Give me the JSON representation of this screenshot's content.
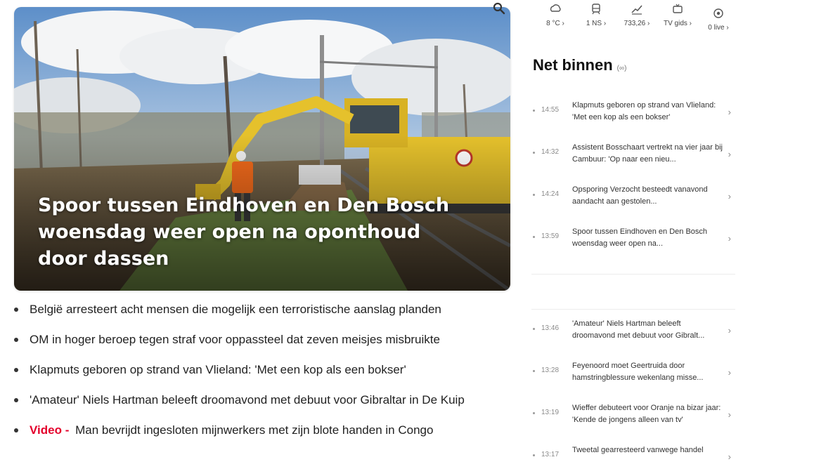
{
  "hero": {
    "title": "Spoor tussen Eindhoven en Den Bosch woensdag weer open na oponthoud door dassen"
  },
  "headlines": [
    {
      "text": "België arresteert acht mensen die mogelijk een terroristische aanslag planden"
    },
    {
      "text": "OM in hoger beroep tegen straf voor oppassteel dat zeven meisjes misbruikte"
    },
    {
      "text": "Klapmuts geboren op strand van Vlieland: 'Met een kop als een bokser'"
    },
    {
      "text": "'Amateur' Niels Hartman beleeft droomavond met debuut voor Gibraltar in De Kuip"
    },
    {
      "tag": "Video -",
      "text": "Man bevrijdt ingesloten mijnwerkers met zijn blote handen in Congo"
    }
  ],
  "top_strip": [
    {
      "icon": "weather-icon",
      "label": "8 °C ›"
    },
    {
      "icon": "train-icon",
      "label": "1 NS ›"
    },
    {
      "icon": "stocks-icon",
      "label": "733,26 ›"
    },
    {
      "icon": "tv-icon",
      "label": "TV gids ›"
    },
    {
      "icon": "live-icon",
      "label": "0 live ›"
    }
  ],
  "net_binnen": {
    "title": "Net binnen",
    "more": "(∞)"
  },
  "feed_group1": [
    {
      "time": "14:55",
      "text": "Klapmuts geboren op strand van Vlieland: 'Met een kop als een bokser'"
    },
    {
      "time": "14:32",
      "text": "Assistent Bosschaart vertrekt na vier jaar bij Cambuur: 'Op naar een nieu..."
    },
    {
      "time": "14:24",
      "text": "Opsporing Verzocht besteedt vanavond aandacht aan gestolen..."
    },
    {
      "time": "13:59",
      "text": "Spoor tussen Eindhoven en Den Bosch woensdag weer open na..."
    }
  ],
  "feed_group2": [
    {
      "time": "13:46",
      "text": "'Amateur' Niels Hartman beleeft droomavond met debuut voor Gibralt..."
    },
    {
      "time": "13:28",
      "text": "Feyenoord moet Geertruida door hamstringblessure wekenlang misse..."
    },
    {
      "time": "13:19",
      "text": "Wieffer debuteert voor Oranje na bizar jaar: 'Kende de jongens alleen van tv'"
    },
    {
      "time": "13:17",
      "text": "Tweetal gearresteerd vanwege handel"
    }
  ],
  "colors": {
    "video_tag": "#e4002b",
    "machine_yellow": "#e5c12c",
    "worker_orange": "#f26a1b"
  }
}
